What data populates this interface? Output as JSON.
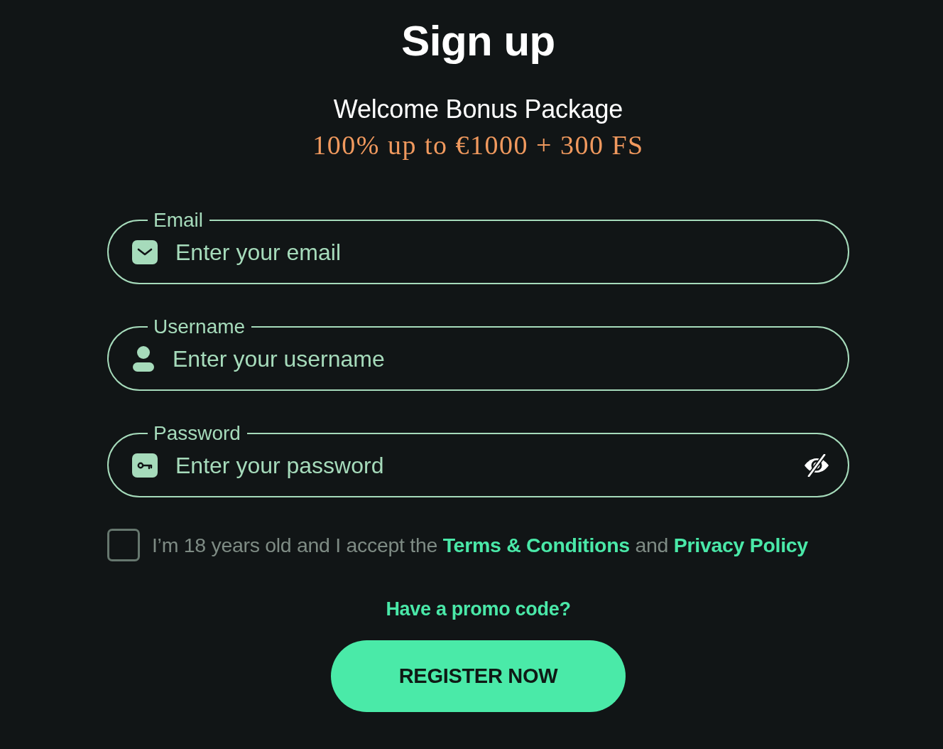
{
  "title": "Sign up",
  "bonus": {
    "heading": "Welcome Bonus Package",
    "offer": "100% up to €1000 + 300 FS"
  },
  "fields": [
    {
      "kind": "email",
      "label": "Email",
      "placeholder": "Enter your email"
    },
    {
      "kind": "username",
      "label": "Username",
      "placeholder": "Enter your username"
    },
    {
      "kind": "password",
      "label": "Password",
      "placeholder": "Enter your password"
    }
  ],
  "consent": {
    "checked": false,
    "parts": [
      {
        "kind": "text",
        "text": "I’m 18 years old and I accept the "
      },
      {
        "kind": "link",
        "text": "Terms & Conditions"
      },
      {
        "kind": "text",
        "text": " and "
      },
      {
        "kind": "link",
        "text": "Privacy Policy"
      }
    ]
  },
  "promo_link": "Have a promo code?",
  "submit_button": "REGISTER NOW"
}
